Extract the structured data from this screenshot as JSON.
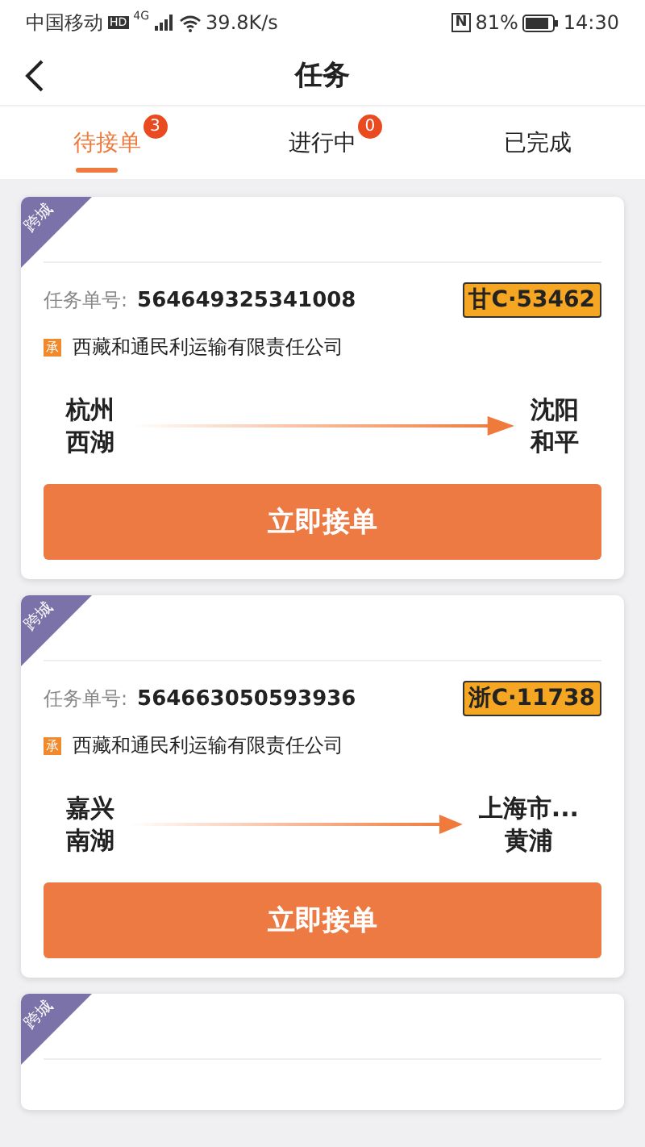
{
  "status_bar": {
    "carrier": "中国移动",
    "hd": "HD",
    "network": "4G",
    "speed": "39.8K/s",
    "nfc": "N",
    "battery": "81%",
    "time": "14:30"
  },
  "header": {
    "title": "任务"
  },
  "tabs": [
    {
      "label": "待接单",
      "badge": "3",
      "selected": true
    },
    {
      "label": "进行中",
      "badge": "0",
      "selected": false
    },
    {
      "label": "已完成",
      "selected": false
    }
  ],
  "tasks": [
    {
      "tag": "跨城",
      "order_label": "任务单号:",
      "order_no": "564649325341008",
      "plate": "甘C·53462",
      "company_mark": "承",
      "company": "西藏和通民利运输有限责任公司",
      "from": [
        "杭州",
        "西湖"
      ],
      "to": [
        "沈阳",
        "和平"
      ],
      "button": "立即接单"
    },
    {
      "tag": "跨城",
      "order_label": "任务单号:",
      "order_no": "564663050593936",
      "plate": "浙C·11738",
      "company_mark": "承",
      "company": "西藏和通民利运输有限责任公司",
      "from": [
        "嘉兴",
        "南湖"
      ],
      "to": [
        "上海市...",
        "黄浦"
      ],
      "button": "立即接单"
    },
    {
      "tag": "跨城"
    }
  ]
}
